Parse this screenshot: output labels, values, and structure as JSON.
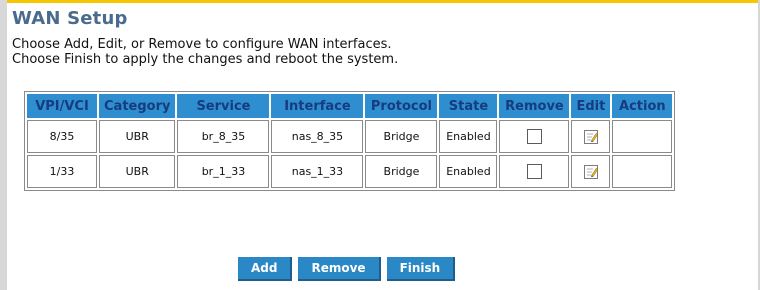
{
  "page": {
    "title": "WAN Setup",
    "desc_line1": "Choose Add, Edit, or Remove to configure WAN interfaces.",
    "desc_line2": "Choose Finish to apply the changes and reboot the system."
  },
  "table": {
    "headers": [
      "VPI/VCI",
      "Category",
      "Service",
      "Interface",
      "Protocol",
      "State",
      "Remove",
      "Edit",
      "Action"
    ],
    "rows": [
      {
        "vpi_vci": "8/35",
        "category": "UBR",
        "service": "br_8_35",
        "interface": "nas_8_35",
        "protocol": "Bridge",
        "state": "Enabled",
        "remove_checked": false,
        "action": ""
      },
      {
        "vpi_vci": "1/33",
        "category": "UBR",
        "service": "br_1_33",
        "interface": "nas_1_33",
        "protocol": "Bridge",
        "state": "Enabled",
        "remove_checked": false,
        "action": ""
      }
    ]
  },
  "buttons": {
    "add": "Add",
    "remove": "Remove",
    "finish": "Finish"
  },
  "icons": {
    "edit": "edit-icon"
  },
  "colors": {
    "title": "#4a6b8e",
    "header_bg": "#2f8ed0",
    "header_text": "#163c7e",
    "button_bg": "#2b88c7",
    "accent_top": "#f6c700"
  }
}
